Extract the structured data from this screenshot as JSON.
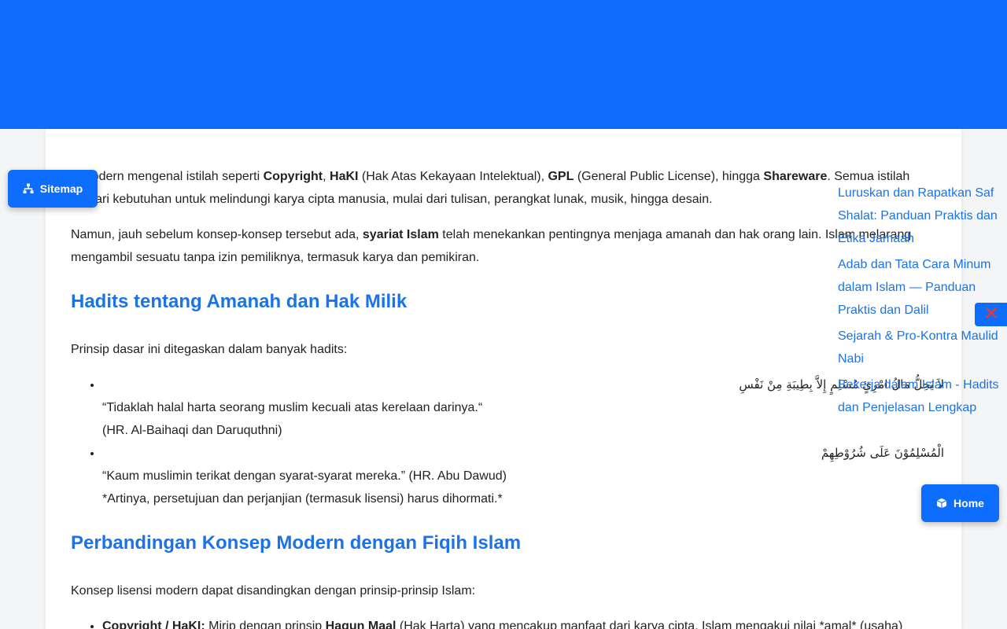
{
  "colors": {
    "accent": "#0d6efd",
    "heading": "#1a73e8",
    "close": "#e53935"
  },
  "buttons": {
    "sitemap": "Sitemap",
    "home": "Home"
  },
  "icons": {
    "sitemap": "sitemap-icon",
    "home": "box-icon",
    "close": "close-icon"
  },
  "article": {
    "p1": {
      "t1": "a modern mengenal istilah seperti ",
      "b1": "Copyright",
      "t2": ", ",
      "b2": "HaKI",
      "t3": " (Hak Atas Kekayaan Intelektual), ",
      "b3": "GPL",
      "t4": " (General Public License), hingga ",
      "b4": "Shareware",
      "t5": ". Semua istilah",
      "t6": "hir dari kebutuhan untuk melindungi karya cipta manusia, mulai dari tulisan, perangkat lunak, musik, hingga desain."
    },
    "p2": {
      "t1": "Namun, jauh sebelum konsep-konsep tersebut ada, ",
      "b1": "syariat Islam",
      "t2": " telah menekankan pentingnya menjaga amanah dan hak orang lain. Islam melarang",
      "t3": "mengambil sesuatu tanpa izin pemiliknya, termasuk karya dan pemikiran."
    },
    "h2a": "Hadits tentang Amanah dan Hak Milik",
    "p3": "Prinsip dasar ini ditegaskan dalam banyak hadits:",
    "hadith1": {
      "arabic": "لاَ يَحِلُّ مَالُ امْرِئٍ مُسْلِمٍ إِلاَّ بِطِيبَةِ مِنْ نَفْسِ",
      "translation": "“Tidaklah halal harta seorang muslim kecuali atas kerelaan darinya.“",
      "source": "(HR. Al-Baihaqi dan Daruquthni)"
    },
    "hadith2": {
      "arabic": "الْمُسْلِمُوْنَ عَلَى شُرُوْطِهِمْ",
      "translation": "“Kaum muslimin terikat dengan syarat-syarat mereka.” (HR. Abu Dawud)",
      "note": "*Artinya, persetujuan dan perjanjian (termasuk lisensi) harus dihormati.*"
    },
    "h2b": "Perbandingan Konsep Modern dengan Fiqih Islam",
    "p4": "Konsep lisensi modern dapat disandingkan dengan prinsip-prinsip Islam:",
    "li1": {
      "b1": "Copyright / HaKI:",
      "t1": " Mirip dengan prinsip ",
      "b2": "Haqun Maal",
      "t2": " (Hak Harta) yang mencakup manfaat dari karya cipta. Islam mengakui nilai *amal* (usaha)"
    }
  },
  "sidebar": {
    "links": [
      "Luruskan dan Rapatkan Saf Shalat: Panduan Praktis dan Etika Jamaah",
      "Adab dan Tata Cara Minum dalam Islam — Panduan Praktis dan Dalil",
      "Sejarah & Pro-Kontra Maulid Nabi",
      "Bekerja dalam Islam - Hadits dan Penjelasan Lengkap"
    ]
  }
}
